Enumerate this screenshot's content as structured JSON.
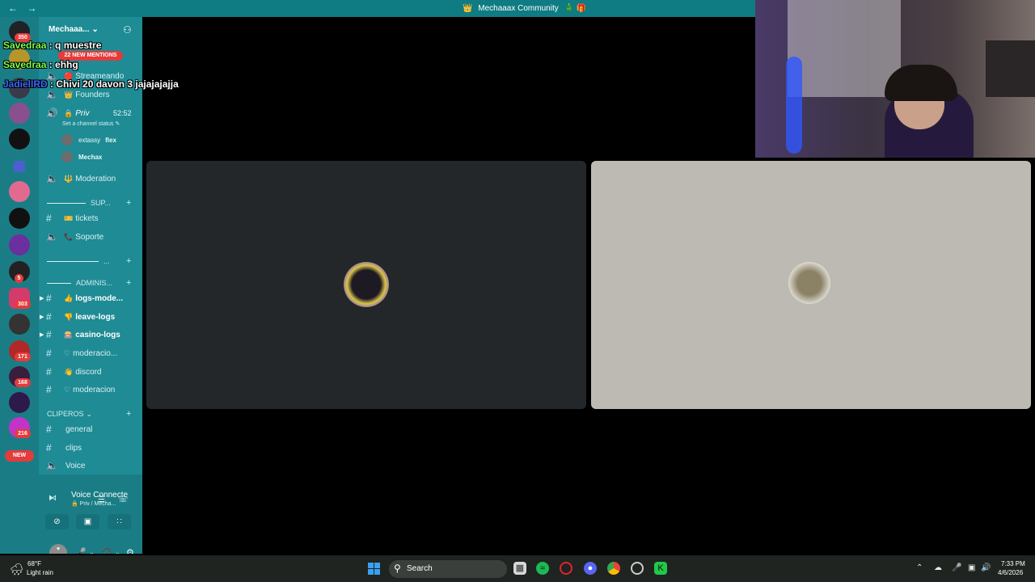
{
  "titlebar": {
    "back": "←",
    "forward": "→",
    "title": "Mechaaax Community",
    "left_emoji": "👑",
    "right_emoji": "🎄 🎁"
  },
  "server_badges": [
    "350",
    "5",
    "303",
    "171",
    "168",
    "216"
  ],
  "new_badge": "NEW",
  "server": {
    "name": "Mechaaa...",
    "mentions": "22 NEW MENTIONS"
  },
  "channels": {
    "streamando": "Streameando",
    "founders": "Founders",
    "priv": "Priv",
    "priv_timer": "52:52",
    "set_status": "Set a channel status",
    "members": [
      {
        "name": "extassy",
        "tag": "flex"
      },
      {
        "name": "Mechax",
        "tag": ""
      }
    ],
    "moderation": "Moderation",
    "cat_sup": "SUP...",
    "tickets": "tickets",
    "soporte": "Soporte",
    "cat_dots": "...",
    "cat_admin": "ADMINIS...",
    "logs_mod": "logs-mode...",
    "leave_logs": "leave-logs",
    "casino_logs": "casino-logs",
    "moderacio": "moderacio...",
    "discord": "discord",
    "moderacion": "moderacion",
    "cat_clip": "CLIPEROS",
    "general": "general",
    "clips": "clips",
    "voice": "Voice"
  },
  "voice": {
    "title": "Voice Connecte",
    "subtitle": "Priv / Mecha..."
  },
  "chat": [
    {
      "user": "Savedraa",
      "text": ": q muestre"
    },
    {
      "user": "Savedraa",
      "text": ": ehhg"
    },
    {
      "user": "JadielIRD",
      "text": ": Chivi 20 davon 3 jajajajajja"
    }
  ],
  "taskbar": {
    "temp": "68°F",
    "weather": "Light rain",
    "search": "Search",
    "time": "7:33 PM",
    "date": "4/6/2026"
  }
}
